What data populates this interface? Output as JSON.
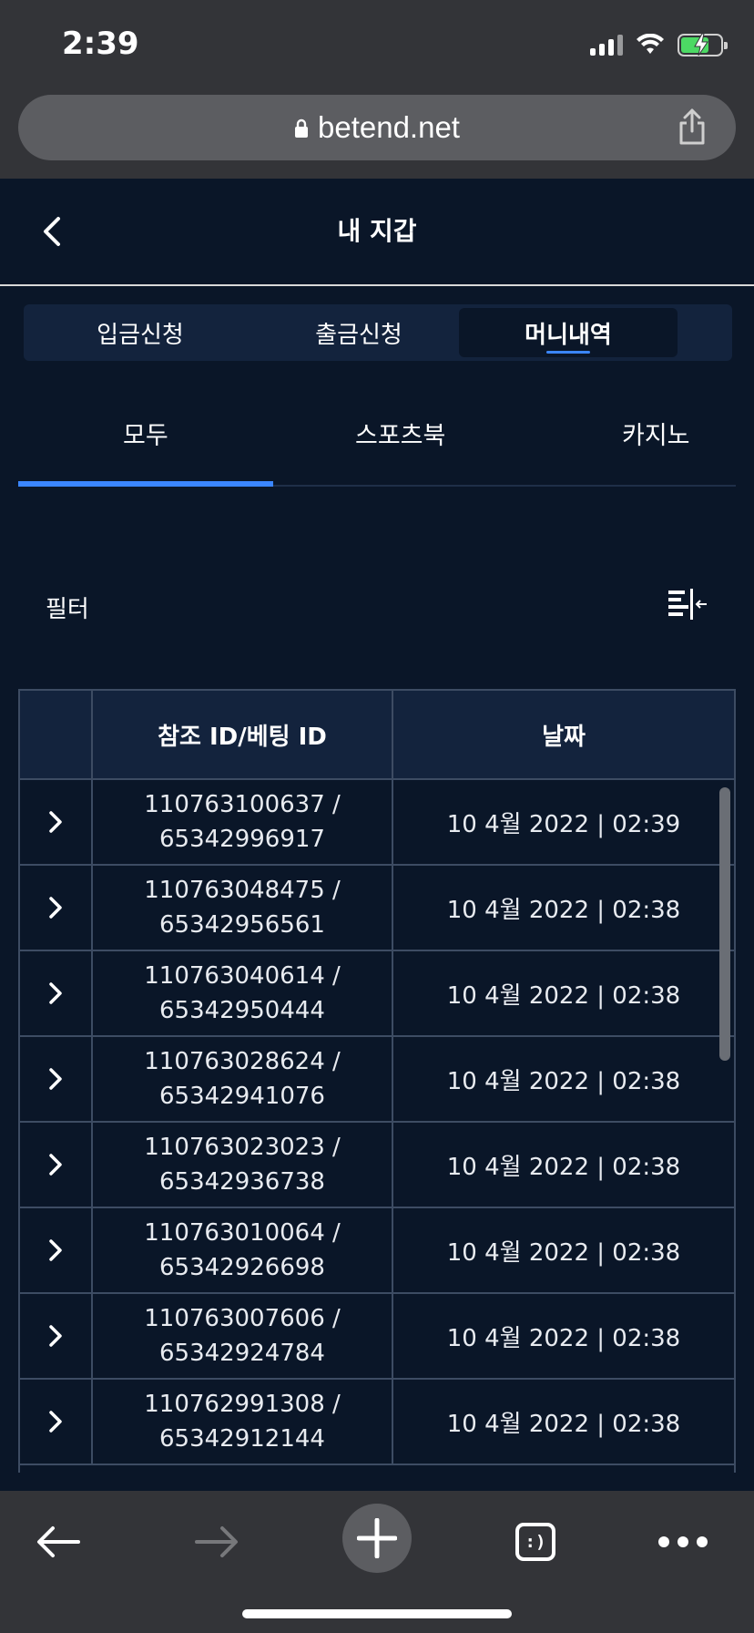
{
  "status_bar": {
    "time": "2:39"
  },
  "browser": {
    "url": "betend.net"
  },
  "header": {
    "title": "내 지갑"
  },
  "segment_tabs": [
    {
      "label": "입금신청"
    },
    {
      "label": "출금신청"
    },
    {
      "label": "머니내역",
      "active": true
    }
  ],
  "category_tabs": [
    {
      "label": "모두",
      "active": true
    },
    {
      "label": "스포츠북"
    },
    {
      "label": "카지노"
    }
  ],
  "filter": {
    "label": "필터"
  },
  "table": {
    "columns": [
      "",
      "참조 ID/베팅 ID",
      "날짜"
    ],
    "rows": [
      {
        "ref_id": "110763100637 /",
        "bet_id": "65342996917",
        "date": "10 4월 2022 | 02:39"
      },
      {
        "ref_id": "110763048475 /",
        "bet_id": "65342956561",
        "date": "10 4월 2022 | 02:38"
      },
      {
        "ref_id": "110763040614 /",
        "bet_id": "65342950444",
        "date": "10 4월 2022 | 02:38"
      },
      {
        "ref_id": "110763028624 /",
        "bet_id": "65342941076",
        "date": "10 4월 2022 | 02:38"
      },
      {
        "ref_id": "110763023023 /",
        "bet_id": "65342936738",
        "date": "10 4월 2022 | 02:38"
      },
      {
        "ref_id": "110763010064 /",
        "bet_id": "65342926698",
        "date": "10 4월 2022 | 02:38"
      },
      {
        "ref_id": "110763007606 /",
        "bet_id": "65342924784",
        "date": "10 4월 2022 | 02:38"
      },
      {
        "ref_id": "110762991308 /",
        "bet_id": "65342912144",
        "date": "10 4월 2022 | 02:38"
      }
    ]
  },
  "toolbar": {
    "tabs_label": ":)"
  },
  "colors": {
    "background": "#0a1628",
    "accent": "#3b86ff",
    "panel": "#13233d",
    "chrome": "#333438"
  }
}
